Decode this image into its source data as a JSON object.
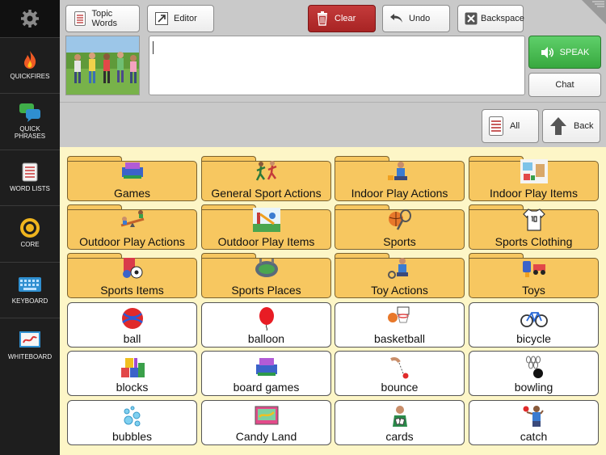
{
  "sidebar": {
    "items": [
      {
        "label": "QUICKFIRES",
        "icon": "flame-icon"
      },
      {
        "label": "QUICK PHRASES",
        "icon": "speech-bubbles-icon"
      },
      {
        "label": "WORD LISTS",
        "icon": "list-icon"
      },
      {
        "label": "CORE",
        "icon": "target-icon"
      },
      {
        "label": "KEYBOARD",
        "icon": "keyboard-icon"
      },
      {
        "label": "WHITEBOARD",
        "icon": "whiteboard-icon"
      }
    ]
  },
  "toolbar": {
    "topic_words": "Topic Words",
    "editor": "Editor",
    "clear": "Clear",
    "undo": "Undo",
    "backspace": "Backspace",
    "speak": "SPEAK",
    "chat": "Chat"
  },
  "nav": {
    "all": "All",
    "back": "Back"
  },
  "colors": {
    "folder": "#f7c760",
    "grid_bg": "#fdf6c7",
    "clear_red": "#b32c2c",
    "speak_green": "#43b64b"
  },
  "grid": {
    "folders": [
      "Games",
      "General Sport Actions",
      "Indoor Play Actions",
      "Indoor Play Items",
      "Outdoor Play Actions",
      "Outdoor Play Items",
      "Sports",
      "Sports Clothing",
      "Sports Items",
      "Sports Places",
      "Toy Actions",
      "Toys"
    ],
    "words": [
      "ball",
      "balloon",
      "basketball",
      "bicycle",
      "blocks",
      "board games",
      "bounce",
      "bowling",
      "bubbles",
      "Candy Land",
      "cards",
      "catch"
    ]
  }
}
